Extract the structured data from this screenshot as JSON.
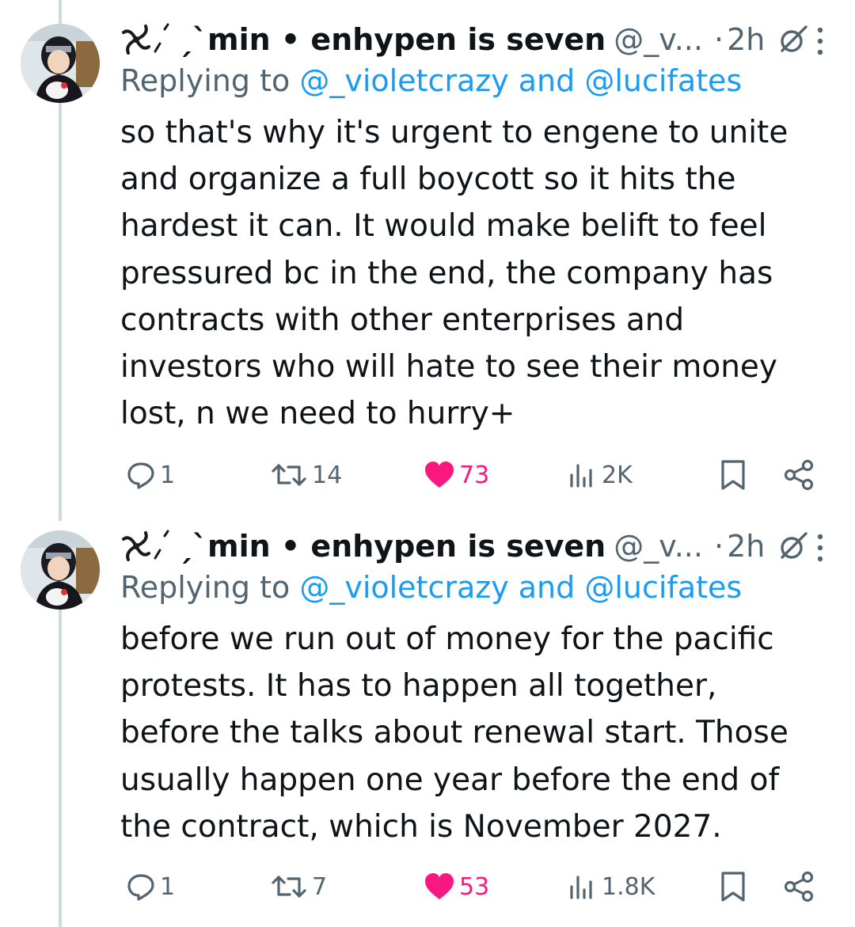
{
  "tweets": [
    {
      "author_name": "ˏˋmin • enhypen is seven",
      "handle": "@_v...",
      "dot": "·",
      "time": "2h",
      "reply_prefix": "Replying to",
      "reply_targets": "@_violetcrazy and @lucifates",
      "text": "so that's why it's urgent to engene to unite\nand organize a full boycott so it hits the\nhardest it can. It would make belift to feel\npressured bc in the end, the company has\ncontracts with other enterprises and\ninvestors who will hate to see their money\nlost, n we need to hurry+",
      "replies": "1",
      "retweets": "14",
      "likes": "73",
      "views": "2K",
      "liked": true
    },
    {
      "author_name": "ˏˋmin • enhypen is seven",
      "handle": "@_v...",
      "dot": "·",
      "time": "2h",
      "reply_prefix": "Replying to",
      "reply_targets": "@_violetcrazy and @lucifates",
      "text": "before we run out of money for the pacific\nprotests. It has to happen all together,\nbefore the talks about renewal start. Those\nusually happen one year before the end of\nthe contract, which is November 2027.",
      "replies": "1",
      "retweets": "7",
      "likes": "53",
      "views": "1.8K",
      "liked": true
    }
  ],
  "icons": {
    "header": "pinwheel-emoji-icon",
    "grok": "grok-icon",
    "more": "more-vertical-icon",
    "reply": "reply-icon",
    "retweet": "retweet-icon",
    "like": "heart-filled-icon",
    "views": "views-icon",
    "bookmark": "bookmark-icon",
    "share": "share-icon"
  },
  "colors": {
    "text": "#0f1419",
    "muted": "#536471",
    "link": "#1d9bf0",
    "like": "#f91880",
    "thread_line": "#cfd9de"
  }
}
